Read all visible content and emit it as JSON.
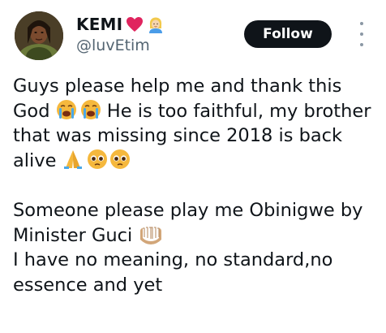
{
  "author": {
    "display_name": "KEMI",
    "name_emoji": [
      "heart-icon",
      "woman-emoji-icon"
    ],
    "handle": "@luvEtim"
  },
  "actions": {
    "follow_label": "Follow",
    "more_icon": "more-vertical-icon"
  },
  "tweet": {
    "p1_part1": "Guys please help me and thank this God ",
    "p1_part2": " He is too faithful, my brother that was missing since 2018 is back alive ",
    "p2_part1": "Someone please play me Obinigwe by Minister Guci ",
    "p2_part2": "I have no meaning, no standard,no essence and yet"
  },
  "colors": {
    "text": "#0f1419",
    "handle": "#536471",
    "button_bg": "#0f1419",
    "heart": "#e0245e"
  }
}
